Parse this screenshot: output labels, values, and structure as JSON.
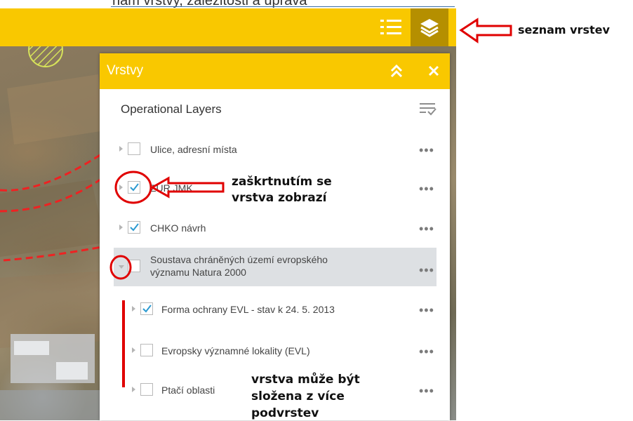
{
  "top_partial_text": "nám vrstvy, záležitosti a úprava",
  "toolbar": {
    "list_icon": "list-icon",
    "layers_icon": "layers-icon",
    "accent": "#f9c800",
    "active_bg": "#b58f00"
  },
  "annotations": {
    "seznam_vrstev": "seznam vrstev",
    "check_line1": "zaškrtnutím se",
    "check_line2": "vrstva zobrazí",
    "sub_line1": "vrstva může být",
    "sub_line2": "složena z více",
    "sub_line3": "podvrstev",
    "annotation_color": "#e00000"
  },
  "panel": {
    "title": "Vrstvy",
    "collapse_icon": "double-chevron-up-icon",
    "close_icon": "close-icon",
    "section_title": "Operational Layers",
    "filter_icon": "filter-list-icon",
    "more_label": "•••",
    "layers": [
      {
        "label": "Ulice, adresní místa",
        "checked": false,
        "expanded": false
      },
      {
        "label": "ZÚR JMK",
        "checked": true,
        "expanded": false
      },
      {
        "label": "CHKO návrh",
        "checked": true,
        "expanded": false
      },
      {
        "label_line1": "Soustava chráněných území evropského",
        "label_line2": "významu Natura 2000",
        "checked": false,
        "expanded": true
      },
      {
        "label": "Forma ochrany EVL - stav k 24. 5. 2013",
        "checked": true,
        "sublayer": true
      },
      {
        "label": "Evropsky významné lokality (EVL)",
        "checked": false,
        "sublayer": true
      },
      {
        "label": "Ptačí oblasti",
        "checked": false,
        "sublayer": true
      }
    ]
  }
}
